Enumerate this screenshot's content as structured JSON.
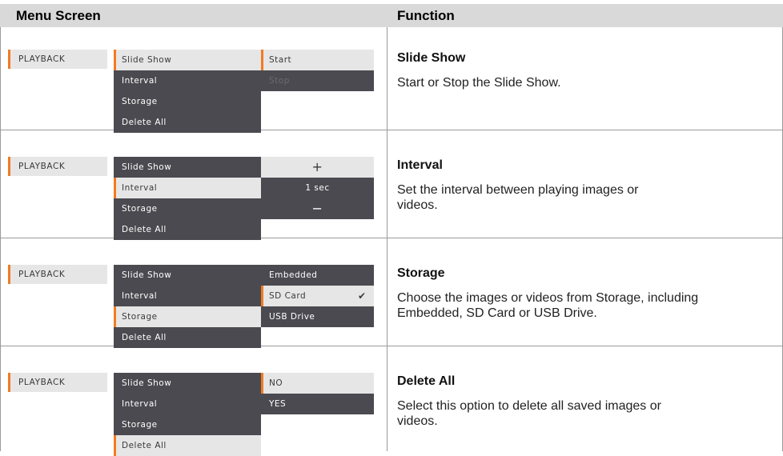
{
  "header": {
    "menu_screen": "Menu Screen",
    "function": "Function"
  },
  "rows": [
    {
      "playback_label": "PLAYBACK",
      "menu_items": [
        "Slide Show",
        "Interval",
        "Storage",
        "Delete All"
      ],
      "options": [
        "Start",
        "Stop"
      ],
      "function_title": "Slide Show",
      "function_desc": "Start or Stop the Slide Show."
    },
    {
      "playback_label": "PLAYBACK",
      "menu_items": [
        "Slide Show",
        "Interval",
        "Storage",
        "Delete All"
      ],
      "options": [
        "+",
        "1 sec",
        "−"
      ],
      "function_title": "Interval",
      "function_desc": "Set the interval between playing images or videos."
    },
    {
      "playback_label": "PLAYBACK",
      "menu_items": [
        "Slide Show",
        "Interval",
        "Storage",
        "Delete All"
      ],
      "options": [
        "Embedded",
        "SD Card",
        "USB Drive"
      ],
      "function_title": "Storage",
      "function_desc": "Choose the images or videos from Storage, including Embedded, SD Card or USB Drive."
    },
    {
      "playback_label": "PLAYBACK",
      "menu_items": [
        "Slide Show",
        "Interval",
        "Storage",
        "Delete All"
      ],
      "options": [
        "NO",
        "YES"
      ],
      "function_title": "Delete All",
      "function_desc": "Select this option to delete all saved images or videos."
    }
  ],
  "icons": {
    "selected_check": "checkmark-icon"
  },
  "colors": {
    "accent": "#f07c22",
    "menu_dark": "#4b4a50",
    "menu_light": "#e6e6e6",
    "header_bg": "#d9d9d9"
  }
}
